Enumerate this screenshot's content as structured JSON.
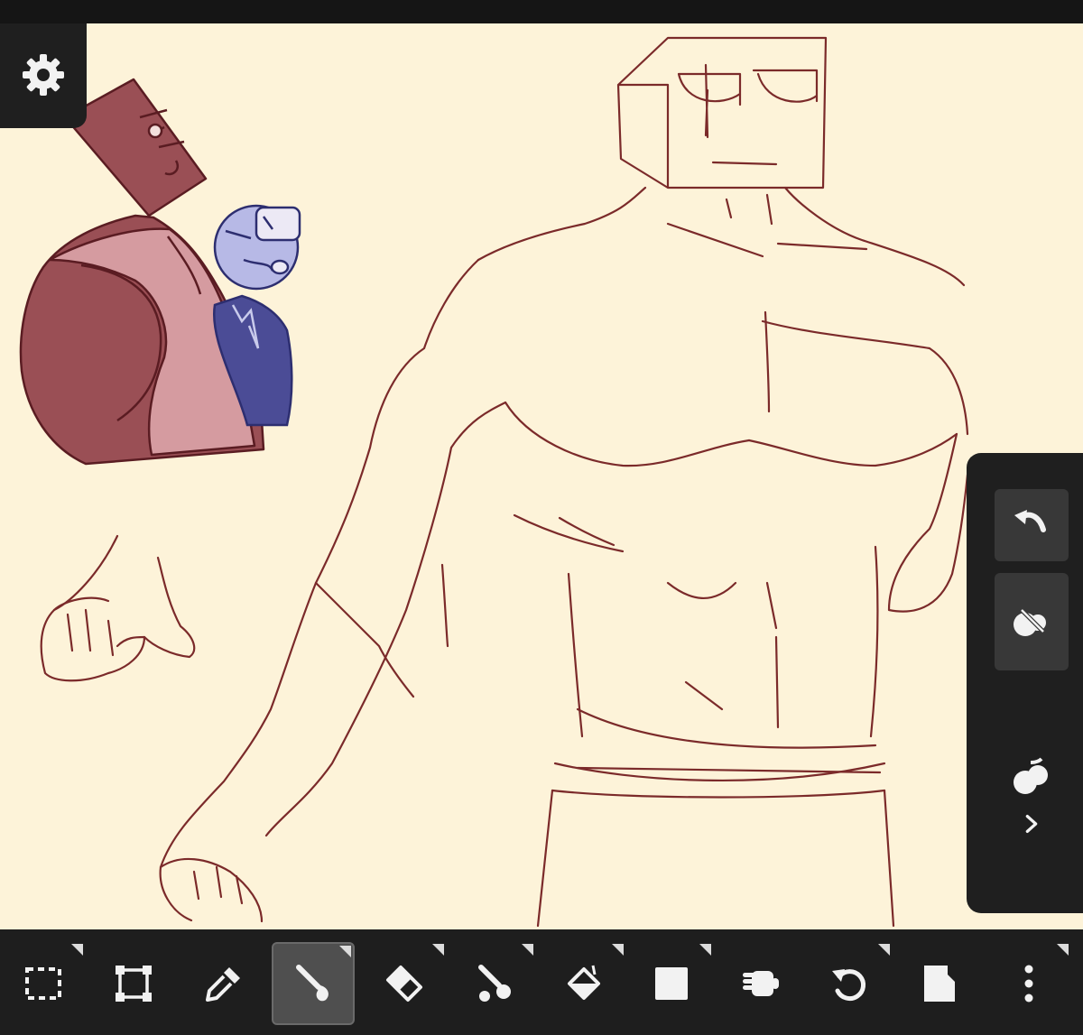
{
  "app": {
    "colors": {
      "canvas_bg": "#fdf3d9",
      "chrome_dark": "#1e1e1e",
      "button_dark": "#383838",
      "icon_fill": "#f2f2f2",
      "ink": "#7b2a2a",
      "red_character": "#9a4f55",
      "blue_character": "#4b4c96"
    }
  },
  "top_left": {
    "settings_icon": "gear-icon"
  },
  "side_panel": {
    "buttons": [
      {
        "name": "undo",
        "icon": "undo-arrow-icon"
      },
      {
        "name": "brush-color",
        "icon": "brush-color-icon"
      }
    ],
    "collapse": {
      "icon": "color-drops-icon",
      "expand_icon": "chevron-right-icon"
    }
  },
  "toolbar": {
    "tools": [
      {
        "name": "selection",
        "icon": "dashed-rect-select-icon",
        "has_options": true,
        "active": false
      },
      {
        "name": "transform",
        "icon": "transform-icon",
        "has_options": false,
        "active": false
      },
      {
        "name": "eyedropper",
        "icon": "eyedropper-icon",
        "has_options": false,
        "active": false
      },
      {
        "name": "brush",
        "icon": "brush-icon",
        "has_options": true,
        "active": true
      },
      {
        "name": "eraser",
        "icon": "eraser-icon",
        "has_options": true,
        "active": false
      },
      {
        "name": "smudge",
        "icon": "smudge-icon",
        "has_options": true,
        "active": false
      },
      {
        "name": "fill",
        "icon": "fill-bucket-icon",
        "has_options": true,
        "active": false
      },
      {
        "name": "shape",
        "icon": "square-shape-icon",
        "has_options": true,
        "active": false
      },
      {
        "name": "hand",
        "icon": "hand-icon",
        "has_options": false,
        "active": false
      },
      {
        "name": "rotate",
        "icon": "rotate-icon",
        "has_options": true,
        "active": false
      },
      {
        "name": "layers",
        "icon": "layers-icon",
        "has_options": false,
        "active": false
      },
      {
        "name": "more",
        "icon": "kebab-menu-icon",
        "has_options": true,
        "active": false
      }
    ]
  }
}
